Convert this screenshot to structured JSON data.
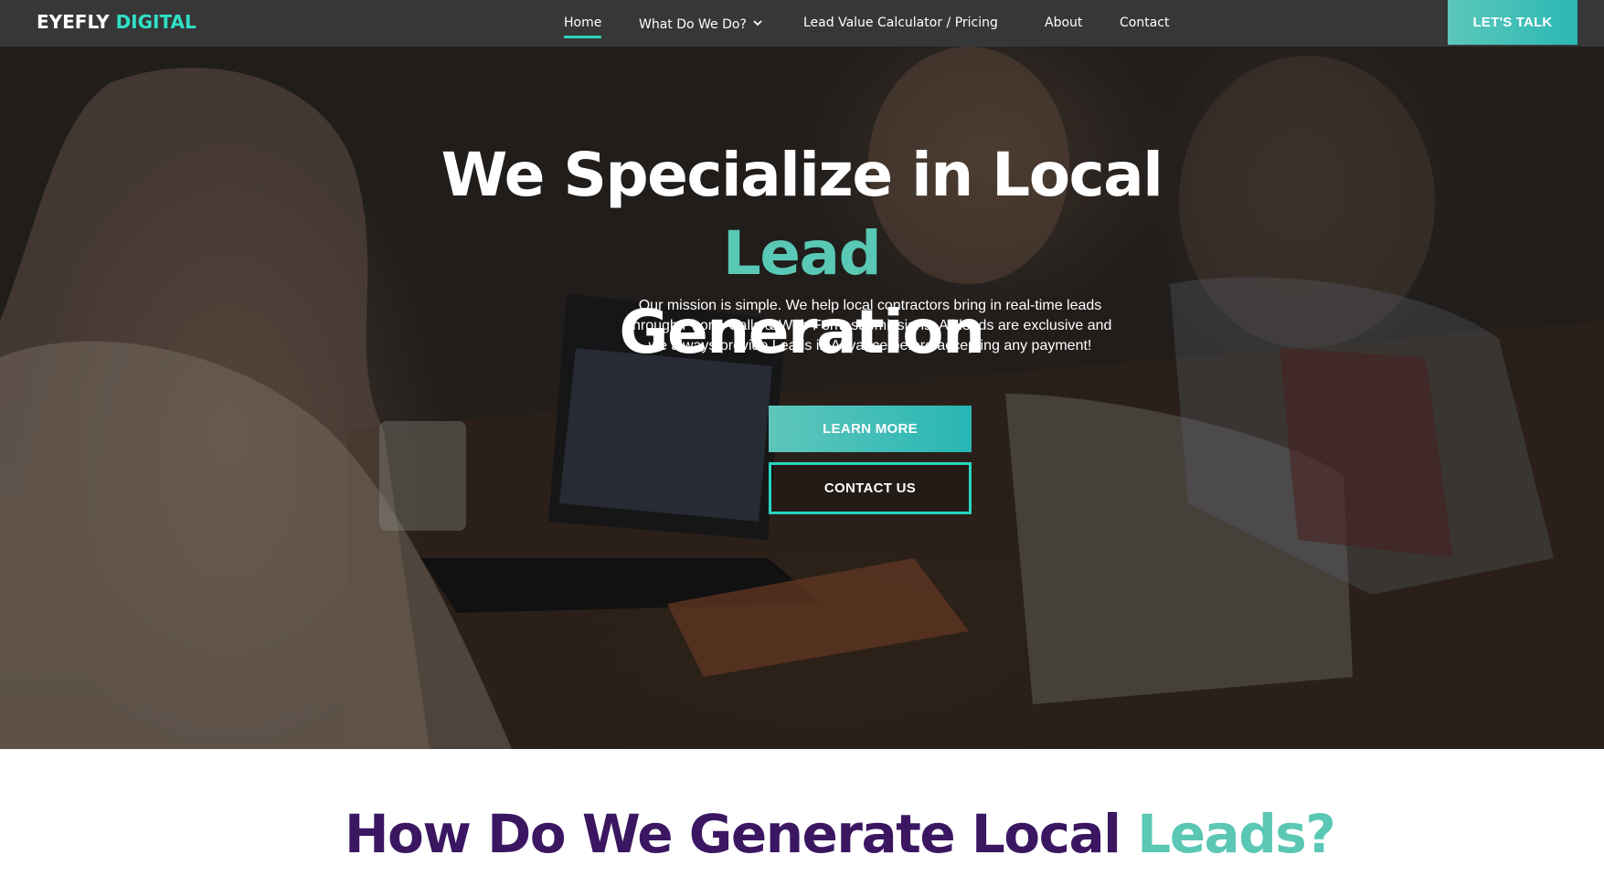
{
  "brand": {
    "logo_main": "EYEFLY",
    "logo_accent": "DIGITAL"
  },
  "nav": {
    "items": [
      {
        "label": "Home",
        "active": true
      },
      {
        "label": "What Do We Do?",
        "has_dropdown": true
      },
      {
        "label": "Lead Value Calculator / Pricing"
      },
      {
        "label": "About"
      },
      {
        "label": "Contact"
      }
    ],
    "cta_label": "LET'S TALK"
  },
  "hero": {
    "title_part1": "We Specialize in Local",
    "title_accent": "Lead",
    "title_part2": "Generation",
    "mission": "Our mission is simple. We help local contractors bring in real-time leads through Phone Calls & Web Form submissions. All leads are exclusive and we always provide Leads in Advance before accepting any payment!",
    "learn_more_label": "LEARN MORE",
    "contact_label": "CONTACT US"
  },
  "section": {
    "title_main": "How Do We Generate Local",
    "title_accent": "Leads?"
  },
  "colors": {
    "nav_bg": "#373737",
    "accent_teal": "#2fd3c2",
    "accent_teal_soft": "#59c8b5",
    "heading_purple": "#3b1762"
  },
  "icons": {
    "dropdown": "chevron-down-icon"
  }
}
